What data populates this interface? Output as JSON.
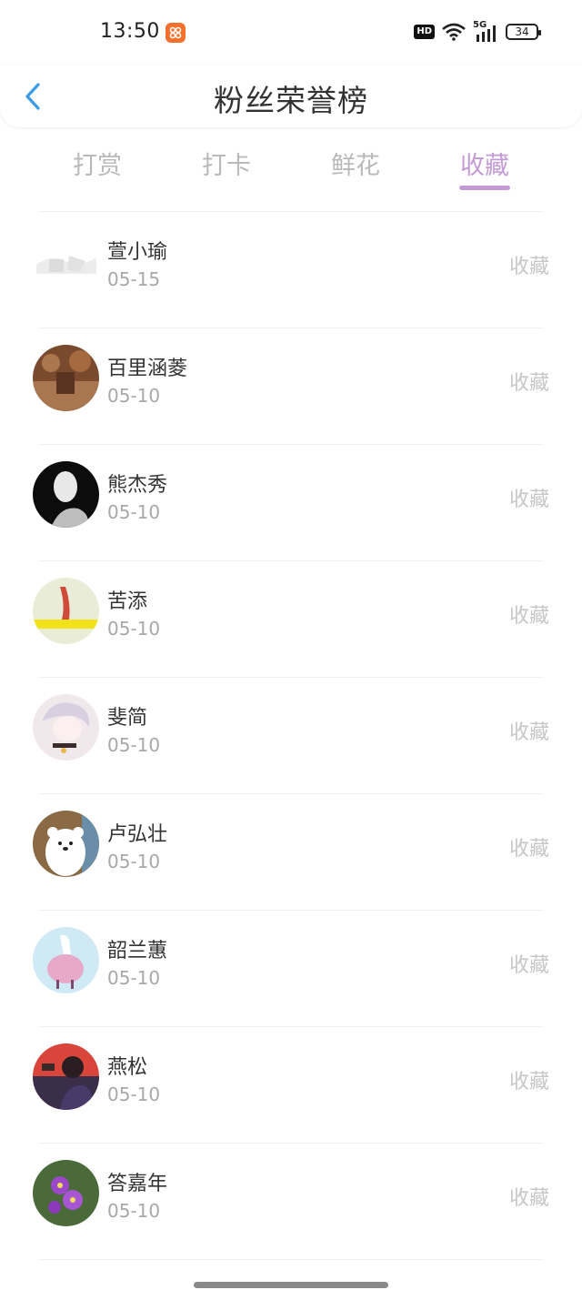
{
  "status_bar": {
    "time": "13:50",
    "hd": "HD",
    "network": "5G",
    "battery": "34"
  },
  "header": {
    "title": "粉丝荣誉榜"
  },
  "tabs": [
    {
      "label": "打赏",
      "active": false
    },
    {
      "label": "打卡",
      "active": false
    },
    {
      "label": "鲜花",
      "active": false
    },
    {
      "label": "收藏",
      "active": true
    }
  ],
  "fans": [
    {
      "name": "萱小瑜",
      "date": "05-15",
      "action": "收藏"
    },
    {
      "name": "百里涵菱",
      "date": "05-10",
      "action": "收藏"
    },
    {
      "name": "熊杰秀",
      "date": "05-10",
      "action": "收藏"
    },
    {
      "name": "苦添",
      "date": "05-10",
      "action": "收藏"
    },
    {
      "name": "斐简",
      "date": "05-10",
      "action": "收藏"
    },
    {
      "name": "卢弘壮",
      "date": "05-10",
      "action": "收藏"
    },
    {
      "name": "韶兰蕙",
      "date": "05-10",
      "action": "收藏"
    },
    {
      "name": "燕松",
      "date": "05-10",
      "action": "收藏"
    },
    {
      "name": "答嘉年",
      "date": "05-10",
      "action": "收藏"
    }
  ],
  "colors": {
    "accent": "#c49ad6",
    "muted": "#b9b9b9",
    "back": "#3a9be8"
  }
}
